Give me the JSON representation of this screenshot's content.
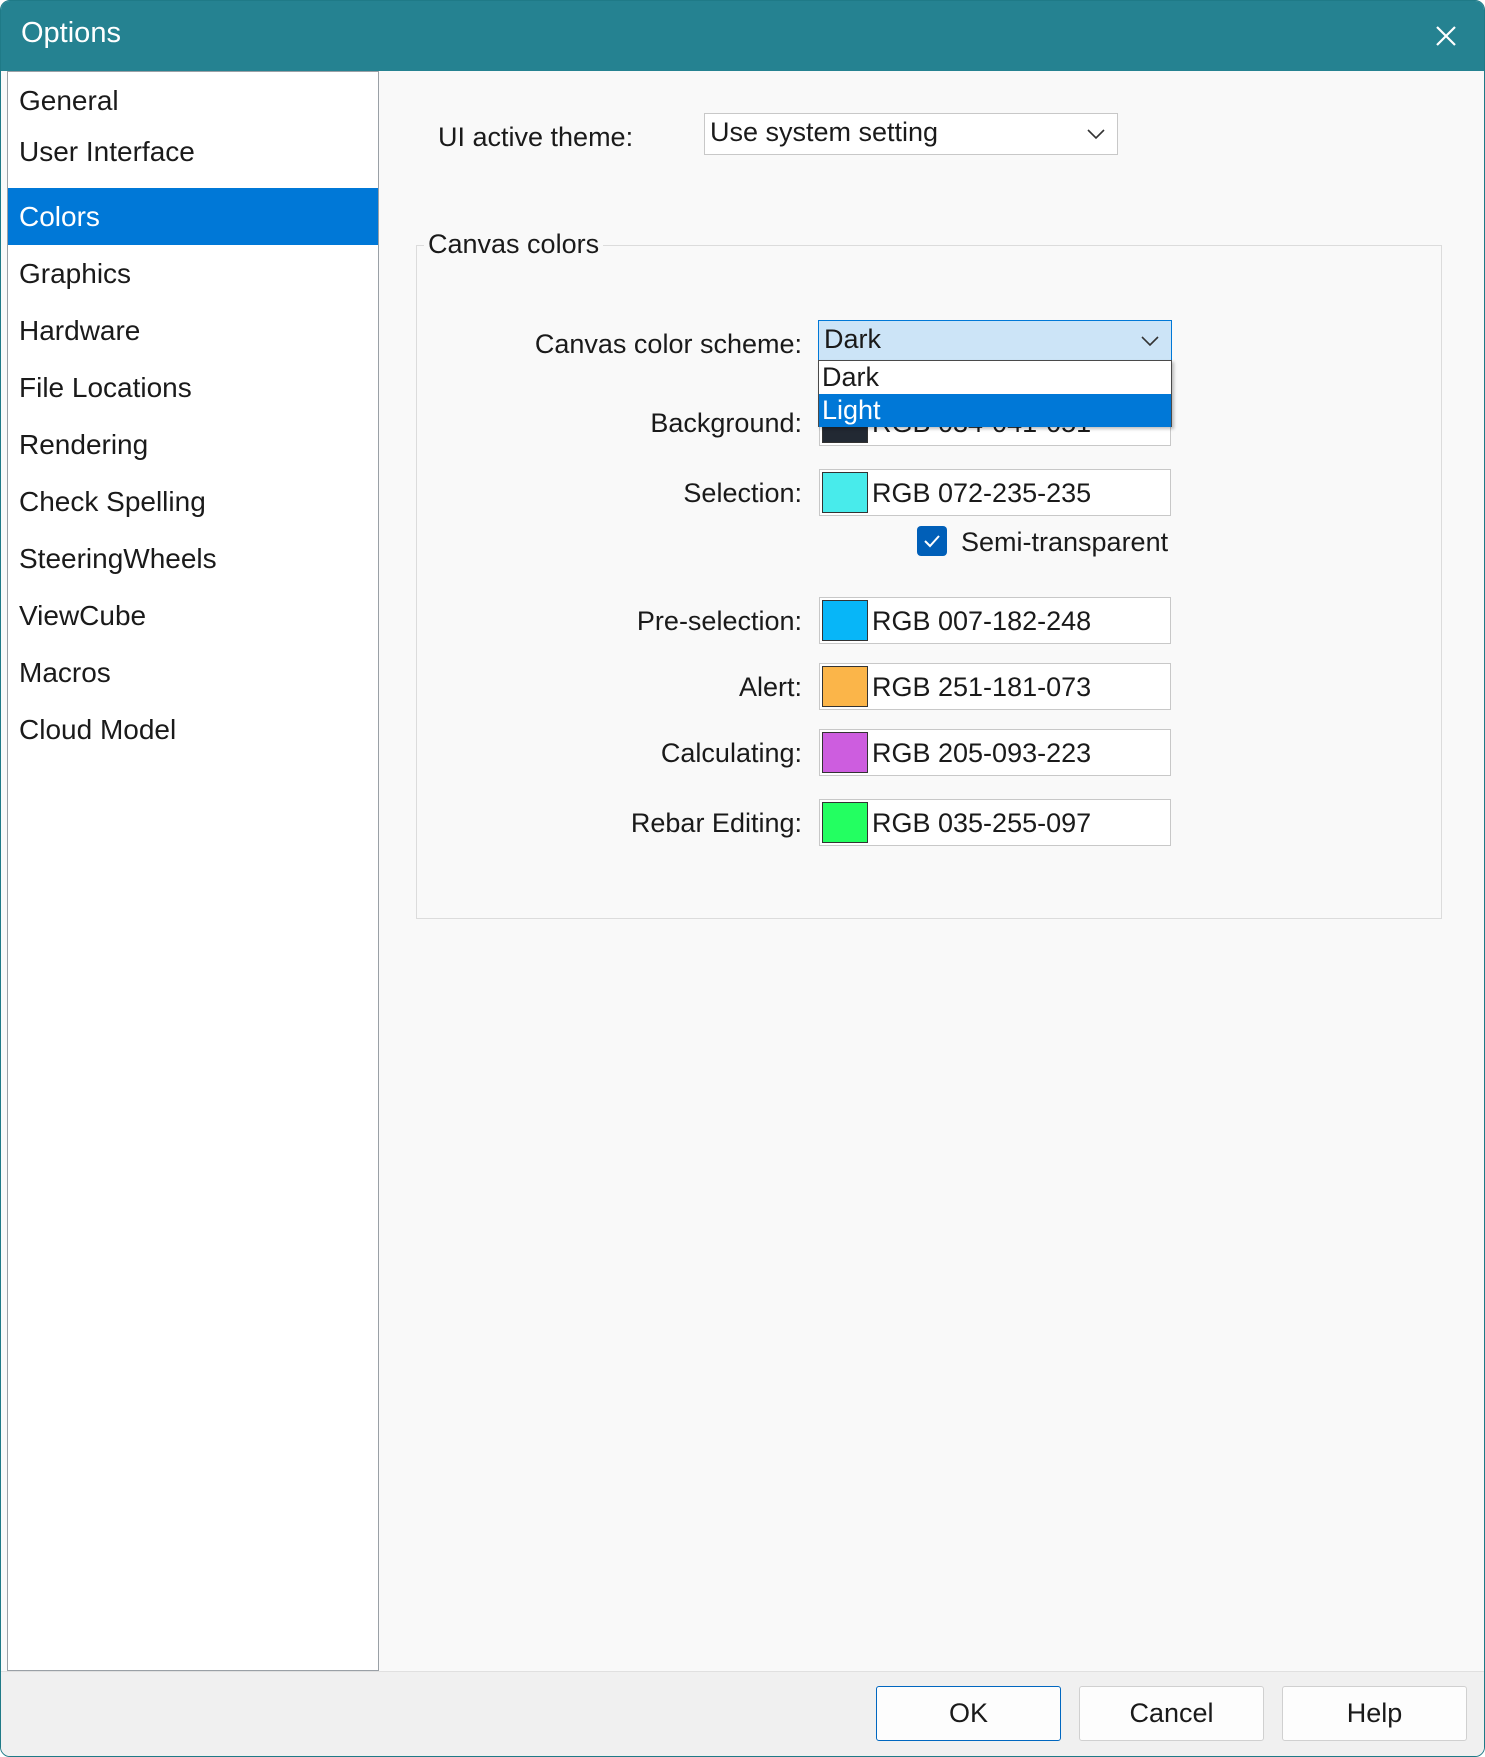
{
  "window": {
    "title": "Options"
  },
  "sidebar": {
    "items": [
      {
        "label": "General"
      },
      {
        "label": "User Interface"
      },
      {
        "label": "Colors",
        "selected": true
      },
      {
        "label": "Graphics"
      },
      {
        "label": "Hardware"
      },
      {
        "label": "File Locations"
      },
      {
        "label": "Rendering"
      },
      {
        "label": "Check Spelling"
      },
      {
        "label": "SteeringWheels"
      },
      {
        "label": "ViewCube"
      },
      {
        "label": "Macros"
      },
      {
        "label": "Cloud Model"
      }
    ]
  },
  "main": {
    "ui_theme_label": "UI active theme:",
    "ui_theme_value": "Use system setting",
    "canvas_group_title": "Canvas colors",
    "scheme_label": "Canvas color scheme:",
    "scheme_value": "Dark",
    "scheme_options": [
      "Dark",
      "Light"
    ],
    "scheme_highlighted": "Light",
    "colors": [
      {
        "label": "Background:",
        "value": "RGB 034-041-051",
        "hex": "#222933"
      },
      {
        "label": "Selection:",
        "value": "RGB 072-235-235",
        "hex": "#48ebeb"
      },
      {
        "label": "Pre-selection:",
        "value": "RGB 007-182-248",
        "hex": "#07b6f8"
      },
      {
        "label": "Alert:",
        "value": "RGB 251-181-073",
        "hex": "#fbb549"
      },
      {
        "label": "Calculating:",
        "value": "RGB 205-093-223",
        "hex": "#cd5ddf"
      },
      {
        "label": "Rebar Editing:",
        "value": "RGB 035-255-097",
        "hex": "#23ff61"
      }
    ],
    "semi_transparent_label": "Semi-transparent",
    "semi_transparent_checked": true
  },
  "footer": {
    "ok_label": "OK",
    "cancel_label": "Cancel",
    "help_label": "Help"
  },
  "icons": {
    "close": "close-icon",
    "chevron": "chevron-down-icon",
    "check": "checkmark-icon"
  },
  "theme": {
    "titlebar": "#258291",
    "accent": "#0078d7",
    "checkbox": "#005fb8"
  }
}
